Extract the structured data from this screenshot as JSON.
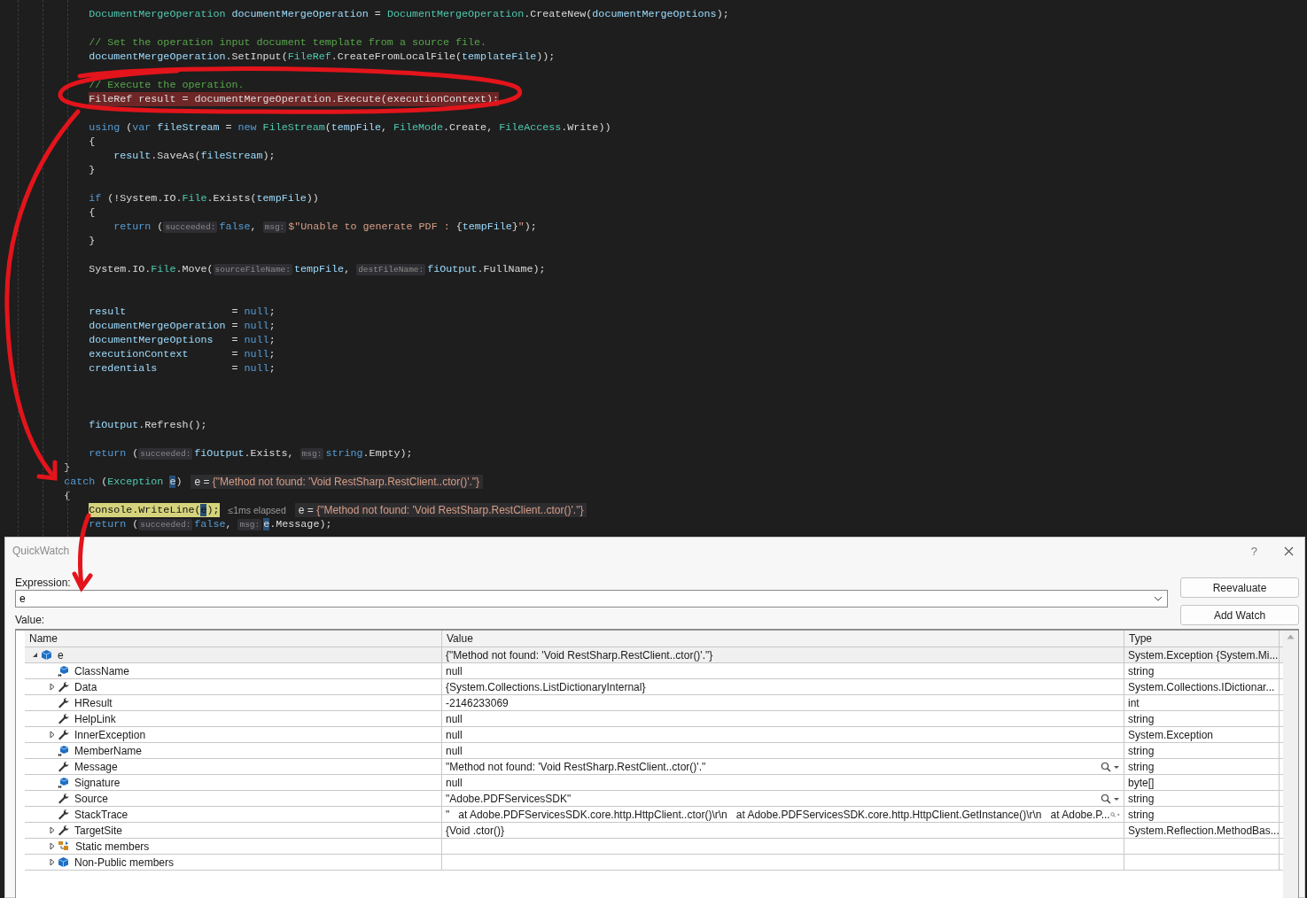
{
  "editor": {
    "lines": [
      {
        "kind": "code",
        "tokens": [
          {
            "kind": "type",
            "text": "              DocumentMergeOperation"
          },
          {
            "kind": "local",
            "text": " documentMergeOperation"
          },
          {
            "kind": "plain",
            "text": " = "
          },
          {
            "kind": "type",
            "text": "DocumentMergeOperation"
          },
          {
            "kind": "plain",
            "text": ".CreateNew("
          },
          {
            "kind": "local",
            "text": "documentMergeOptions"
          },
          {
            "kind": "plain",
            "text": ");"
          }
        ]
      },
      {
        "kind": "blank"
      },
      {
        "kind": "code",
        "tokens": [
          {
            "kind": "comment",
            "text": "              // Set the operation input document template from a source file."
          }
        ]
      },
      {
        "kind": "code",
        "tokens": [
          {
            "kind": "local",
            "text": "              documentMergeOperation"
          },
          {
            "kind": "plain",
            "text": ".SetInput("
          },
          {
            "kind": "type",
            "text": "FileRef"
          },
          {
            "kind": "plain",
            "text": ".CreateFromLocalFile("
          },
          {
            "kind": "local",
            "text": "templateFile"
          },
          {
            "kind": "plain",
            "text": "));"
          }
        ]
      },
      {
        "kind": "blank"
      },
      {
        "kind": "code",
        "tokens": [
          {
            "kind": "comment",
            "text": "              // Execute the operation."
          }
        ]
      },
      {
        "kind": "error",
        "tokens": [
          {
            "kind": "plain",
            "text": "              FileRef result = documentMergeOperation.Execute(executionContext);"
          }
        ]
      },
      {
        "kind": "blank"
      },
      {
        "kind": "code",
        "tokens": [
          {
            "kind": "kw",
            "text": "              using"
          },
          {
            "kind": "plain",
            "text": " ("
          },
          {
            "kind": "kw",
            "text": "var"
          },
          {
            "kind": "local",
            "text": " fileStream"
          },
          {
            "kind": "plain",
            "text": " = "
          },
          {
            "kind": "kw",
            "text": "new"
          },
          {
            "kind": "type",
            "text": " FileStream"
          },
          {
            "kind": "plain",
            "text": "("
          },
          {
            "kind": "local",
            "text": "tempFile"
          },
          {
            "kind": "plain",
            "text": ", "
          },
          {
            "kind": "type",
            "text": "FileMode"
          },
          {
            "kind": "plain",
            "text": ".Create, "
          },
          {
            "kind": "type",
            "text": "FileAccess"
          },
          {
            "kind": "plain",
            "text": ".Write))"
          }
        ]
      },
      {
        "kind": "code",
        "tokens": [
          {
            "kind": "plain",
            "text": "              {"
          }
        ]
      },
      {
        "kind": "code",
        "tokens": [
          {
            "kind": "local",
            "text": "                  result"
          },
          {
            "kind": "plain",
            "text": ".SaveAs("
          },
          {
            "kind": "local",
            "text": "fileStream"
          },
          {
            "kind": "plain",
            "text": ");"
          }
        ]
      },
      {
        "kind": "code",
        "tokens": [
          {
            "kind": "plain",
            "text": "              }"
          }
        ]
      },
      {
        "kind": "blank"
      },
      {
        "kind": "code",
        "tokens": [
          {
            "kind": "kw",
            "text": "              if"
          },
          {
            "kind": "plain",
            "text": " (!System.IO."
          },
          {
            "kind": "type",
            "text": "File"
          },
          {
            "kind": "plain",
            "text": ".Exists("
          },
          {
            "kind": "local",
            "text": "tempFile"
          },
          {
            "kind": "plain",
            "text": "))"
          }
        ]
      },
      {
        "kind": "code",
        "tokens": [
          {
            "kind": "plain",
            "text": "              {"
          }
        ]
      },
      {
        "kind": "code",
        "tokens": [
          {
            "kind": "kw",
            "text": "                  return"
          },
          {
            "kind": "plain",
            "text": " ("
          },
          {
            "kind": "hint",
            "text": "succeeded:"
          },
          {
            "kind": "kw",
            "text": "false"
          },
          {
            "kind": "plain",
            "text": ", "
          },
          {
            "kind": "hint",
            "text": "msg:"
          },
          {
            "kind": "str",
            "text": "$\"Unable to generate PDF : "
          },
          {
            "kind": "plain",
            "text": "{"
          },
          {
            "kind": "local",
            "text": "tempFile"
          },
          {
            "kind": "plain",
            "text": "}"
          },
          {
            "kind": "str",
            "text": "\""
          },
          {
            "kind": "plain",
            "text": ");"
          }
        ]
      },
      {
        "kind": "code",
        "tokens": [
          {
            "kind": "plain",
            "text": "              }"
          }
        ]
      },
      {
        "kind": "blank"
      },
      {
        "kind": "code",
        "tokens": [
          {
            "kind": "plain",
            "text": "              System.IO."
          },
          {
            "kind": "type",
            "text": "File"
          },
          {
            "kind": "plain",
            "text": ".Move("
          },
          {
            "kind": "hint",
            "text": "sourceFileName:"
          },
          {
            "kind": "local",
            "text": "tempFile"
          },
          {
            "kind": "plain",
            "text": ", "
          },
          {
            "kind": "hint",
            "text": "destFileName:"
          },
          {
            "kind": "local",
            "text": "fiOutput"
          },
          {
            "kind": "plain",
            "text": ".FullName);"
          }
        ]
      },
      {
        "kind": "blank"
      },
      {
        "kind": "blank"
      },
      {
        "kind": "code",
        "tokens": [
          {
            "kind": "local",
            "text": "              result"
          },
          {
            "kind": "plain",
            "text": "                 = "
          },
          {
            "kind": "kw",
            "text": "null"
          },
          {
            "kind": "plain",
            "text": ";"
          }
        ]
      },
      {
        "kind": "code",
        "tokens": [
          {
            "kind": "local",
            "text": "              documentMergeOperation"
          },
          {
            "kind": "plain",
            "text": " = "
          },
          {
            "kind": "kw",
            "text": "null"
          },
          {
            "kind": "plain",
            "text": ";"
          }
        ]
      },
      {
        "kind": "code",
        "tokens": [
          {
            "kind": "local",
            "text": "              documentMergeOptions"
          },
          {
            "kind": "plain",
            "text": "   = "
          },
          {
            "kind": "kw",
            "text": "null"
          },
          {
            "kind": "plain",
            "text": ";"
          }
        ]
      },
      {
        "kind": "code",
        "tokens": [
          {
            "kind": "local",
            "text": "              executionContext"
          },
          {
            "kind": "plain",
            "text": "       = "
          },
          {
            "kind": "kw",
            "text": "null"
          },
          {
            "kind": "plain",
            "text": ";"
          }
        ]
      },
      {
        "kind": "code",
        "tokens": [
          {
            "kind": "local",
            "text": "              credentials"
          },
          {
            "kind": "plain",
            "text": "            = "
          },
          {
            "kind": "kw",
            "text": "null"
          },
          {
            "kind": "plain",
            "text": ";"
          }
        ]
      },
      {
        "kind": "blank"
      },
      {
        "kind": "blank"
      },
      {
        "kind": "blank"
      },
      {
        "kind": "code",
        "tokens": [
          {
            "kind": "local",
            "text": "              fiOutput"
          },
          {
            "kind": "plain",
            "text": ".Refresh();"
          }
        ]
      },
      {
        "kind": "blank"
      },
      {
        "kind": "code",
        "tokens": [
          {
            "kind": "kw",
            "text": "              return"
          },
          {
            "kind": "plain",
            "text": " ("
          },
          {
            "kind": "hint",
            "text": "succeeded:"
          },
          {
            "kind": "local",
            "text": "fiOutput"
          },
          {
            "kind": "plain",
            "text": ".Exists, "
          },
          {
            "kind": "hint",
            "text": "msg:"
          },
          {
            "kind": "kw",
            "text": "string"
          },
          {
            "kind": "plain",
            "text": ".Empty);"
          }
        ]
      },
      {
        "kind": "code",
        "tokens": [
          {
            "kind": "plain",
            "text": "          }"
          }
        ]
      },
      {
        "kind": "code",
        "tokens": [
          {
            "kind": "kw",
            "text": "          catch"
          },
          {
            "kind": "plain",
            "text": " ("
          },
          {
            "kind": "type",
            "text": "Exception "
          },
          {
            "kind": "ref",
            "text": "e"
          },
          {
            "kind": "plain",
            "text": ")"
          },
          {
            "kind": "datatip",
            "name": "e = ",
            "text": "{\"Method not found: 'Void RestSharp.RestClient..ctor()'.\"}"
          }
        ]
      },
      {
        "kind": "code",
        "tokens": [
          {
            "kind": "plain",
            "text": "          {"
          }
        ]
      },
      {
        "kind": "current",
        "tokens": [
          {
            "kind": "plain",
            "text": "              Console.WriteLine("
          },
          {
            "kind": "ref",
            "text": "e"
          },
          {
            "kind": "plain",
            "text": ");"
          },
          {
            "kind": "elapsed",
            "text": "≤1ms elapsed"
          },
          {
            "kind": "datatip",
            "name": "e = ",
            "text": "{\"Method not found: 'Void RestSharp.RestClient..ctor()'.\"}"
          }
        ]
      },
      {
        "kind": "code",
        "tokens": [
          {
            "kind": "kw",
            "text": "              return"
          },
          {
            "kind": "plain",
            "text": " ("
          },
          {
            "kind": "hint",
            "text": "succeeded:"
          },
          {
            "kind": "kw",
            "text": "false"
          },
          {
            "kind": "plain",
            "text": ", "
          },
          {
            "kind": "hint",
            "text": "msg:"
          },
          {
            "kind": "ref",
            "text": "e"
          },
          {
            "kind": "plain",
            "text": ".Message);"
          }
        ]
      }
    ]
  },
  "quickwatch": {
    "title": "QuickWatch",
    "help": "?",
    "expression_label": "Expression:",
    "expression": "e",
    "value_label": "Value:",
    "buttons": [
      "Reevaluate",
      "Add Watch"
    ],
    "columns": [
      "Name",
      "Value",
      "Type"
    ],
    "rows": [
      {
        "name": "e",
        "kind": "object",
        "expandable": true,
        "expanded": true,
        "selected": true,
        "visualizer": false,
        "value": "{\"Method not found: 'Void RestSharp.RestClient..ctor()'.\"}",
        "type": "System.Exception {System.Mi...",
        "children": [
          {
            "name": "ClassName",
            "kind": "field",
            "expandable": false,
            "selected": false,
            "visualizer": false,
            "value": "null",
            "type": "string"
          },
          {
            "name": "Data",
            "kind": "property",
            "expandable": true,
            "expanded": false,
            "selected": false,
            "visualizer": false,
            "value": "{System.Collections.ListDictionaryInternal}",
            "type": "System.Collections.IDictionar..."
          },
          {
            "name": "HResult",
            "kind": "property",
            "expandable": false,
            "selected": false,
            "visualizer": false,
            "value": "-2146233069",
            "type": "int"
          },
          {
            "name": "HelpLink",
            "kind": "property",
            "expandable": false,
            "selected": false,
            "visualizer": false,
            "value": "null",
            "type": "string"
          },
          {
            "name": "InnerException",
            "kind": "property",
            "expandable": true,
            "expanded": false,
            "selected": false,
            "visualizer": false,
            "value": "null",
            "type": "System.Exception"
          },
          {
            "name": "MemberName",
            "kind": "field",
            "expandable": false,
            "selected": false,
            "visualizer": false,
            "value": "null",
            "type": "string"
          },
          {
            "name": "Message",
            "kind": "property",
            "expandable": false,
            "selected": false,
            "visualizer": true,
            "value": "\"Method not found: 'Void RestSharp.RestClient..ctor()'.\"",
            "type": "string"
          },
          {
            "name": "Signature",
            "kind": "field",
            "expandable": false,
            "selected": false,
            "visualizer": false,
            "value": "null",
            "type": "byte[]"
          },
          {
            "name": "Source",
            "kind": "property",
            "expandable": false,
            "selected": false,
            "visualizer": true,
            "value": "\"Adobe.PDFServicesSDK\"",
            "type": "string"
          },
          {
            "name": "StackTrace",
            "kind": "property",
            "expandable": false,
            "selected": false,
            "visualizer": true,
            "value": "\"   at Adobe.PDFServicesSDK.core.http.HttpClient..ctor()\\r\\n   at Adobe.PDFServicesSDK.core.http.HttpClient.GetInstance()\\r\\n   at Adobe.P...",
            "type": "string"
          },
          {
            "name": "TargetSite",
            "kind": "property",
            "expandable": true,
            "expanded": false,
            "selected": false,
            "visualizer": false,
            "value": "{Void .ctor()}",
            "type": "System.Reflection.MethodBas..."
          },
          {
            "name": "Static members",
            "kind": "static",
            "expandable": true,
            "expanded": false,
            "selected": false,
            "visualizer": false
          },
          {
            "name": "Non-Public members",
            "kind": "object",
            "expandable": true,
            "expanded": false,
            "selected": false,
            "visualizer": false
          }
        ]
      }
    ]
  }
}
